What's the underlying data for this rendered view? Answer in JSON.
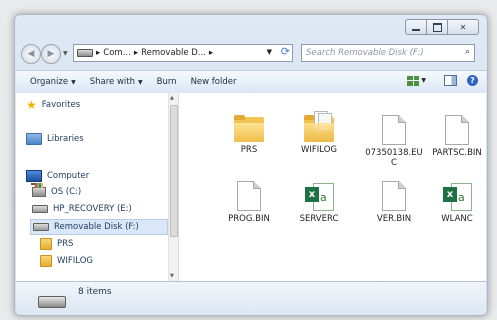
{
  "address": {
    "crumbs": [
      "Com...",
      "Removable D..."
    ],
    "search_placeholder": "Search Removable Disk (F:)"
  },
  "toolbar": {
    "organize": "Organize",
    "share_with": "Share with",
    "burn": "Burn",
    "new_folder": "New folder"
  },
  "nav": {
    "favorites": "Favorites",
    "libraries": "Libraries",
    "computer": "Computer",
    "os": "OS (C:)",
    "hp_recovery": "HP_RECOVERY (E:)",
    "removable": "Removable Disk (F:)",
    "prs": "PRS",
    "wifilog": "WIFILOG"
  },
  "files": [
    {
      "name": "PRS",
      "type": "folder"
    },
    {
      "name": "WIFILOG",
      "type": "folder-docs"
    },
    {
      "name": "07350138.EUC",
      "type": "file"
    },
    {
      "name": "PARTSC.BIN",
      "type": "file"
    },
    {
      "name": "PROG.BIN",
      "type": "file"
    },
    {
      "name": "SERVERC",
      "type": "excel"
    },
    {
      "name": "VER.BIN",
      "type": "file"
    },
    {
      "name": "WLANC",
      "type": "excel"
    }
  ],
  "status": {
    "count": "8 items"
  }
}
